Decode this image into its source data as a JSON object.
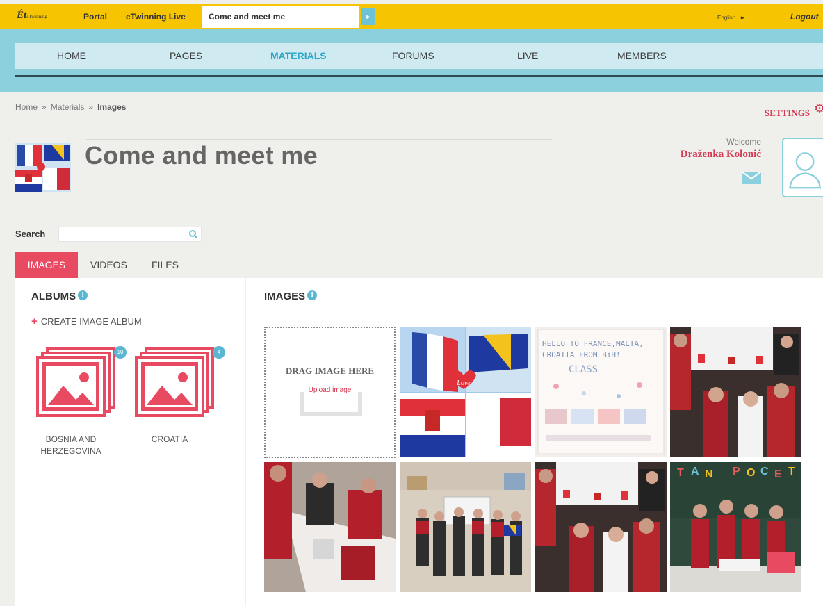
{
  "topbar": {
    "logo": "eTwinning",
    "portal": "Portal",
    "etwinning_live": "eTwinning Live",
    "current_tab": "Come and meet me",
    "language": "English",
    "logout": "Logout"
  },
  "nav": [
    "HOME",
    "PAGES",
    "MATERIALS",
    "FORUMS",
    "LIVE",
    "MEMBERS"
  ],
  "nav_active": "MATERIALS",
  "breadcrumb": {
    "home": "Home",
    "sep": "»",
    "materials": "Materials",
    "current": "Images"
  },
  "settings": "SETTINGS",
  "page_title": "Come and meet me",
  "welcome": "Welcome",
  "user_name": "Draženka Kolonić",
  "search": {
    "label": "Search",
    "value": "",
    "placeholder": ""
  },
  "tabs": [
    "IMAGES",
    "VIDEOS",
    "FILES"
  ],
  "albums": {
    "heading": "ALBUMS",
    "create_label": "CREATE IMAGE ALBUM",
    "items": [
      {
        "name_line1": "BOSNIA AND",
        "name_line2": "HERZEGOVINA",
        "count": "10"
      },
      {
        "name_line1": "CROATIA",
        "name_line2": "",
        "count": "4"
      }
    ]
  },
  "images": {
    "heading": "IMAGES",
    "drop_text": "DRAG IMAGE HERE",
    "upload_link": "Upload image",
    "poster_text_1": "HELLO TO FRANCE,MALTA,",
    "poster_text_2": "CROATIA FROM BiH!",
    "poster_text_3": "CLASS",
    "love": "Love"
  },
  "colors": {
    "accent": "#e84a62",
    "topbar": "#f6c400",
    "nav_band": "#8dd0dd",
    "info": "#5ab7d3"
  }
}
